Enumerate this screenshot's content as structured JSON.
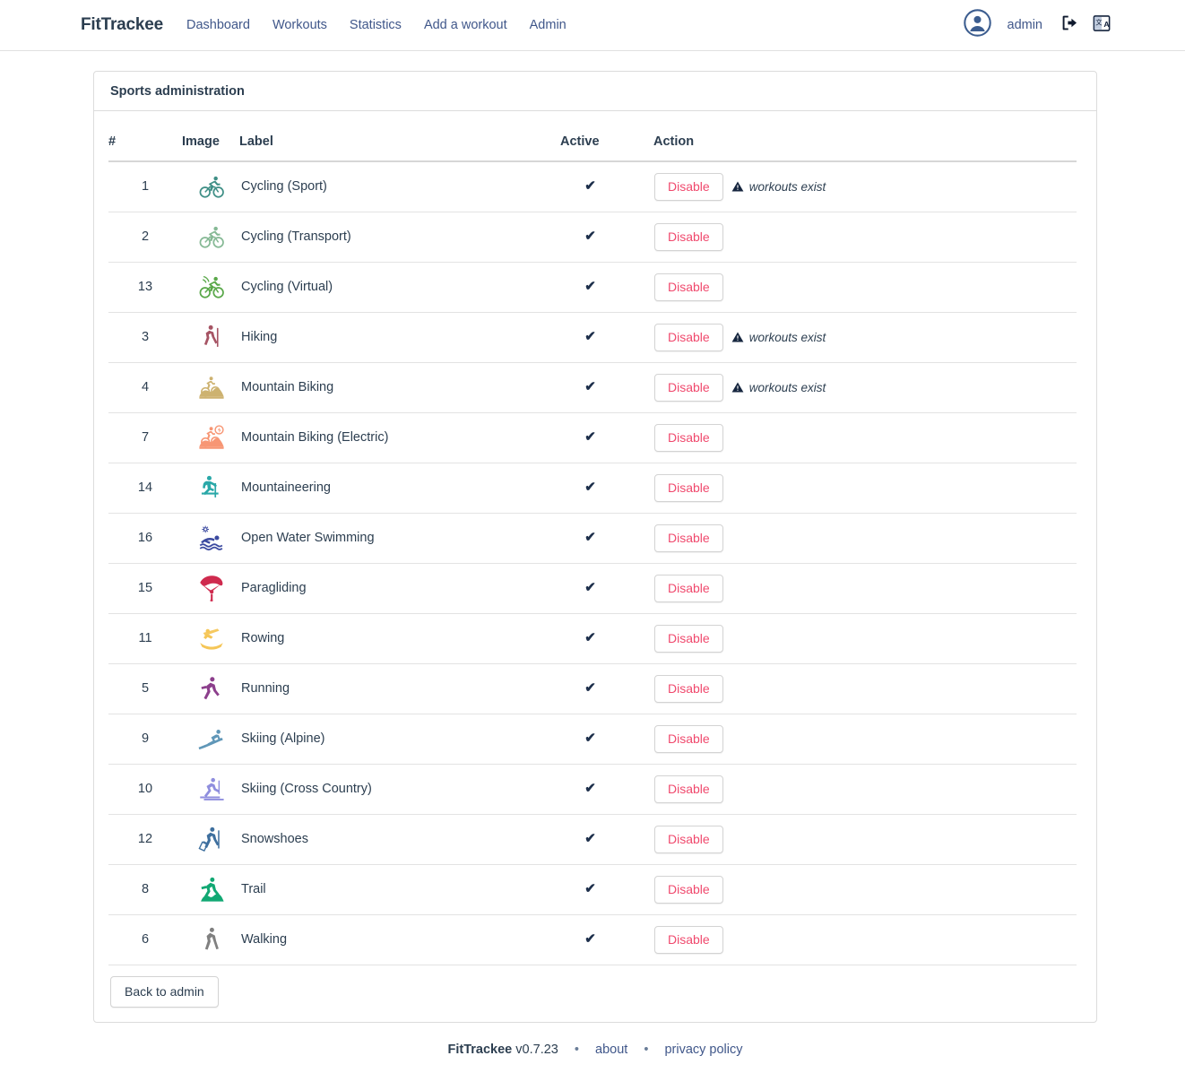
{
  "header": {
    "brand": "FitTrackee",
    "nav": [
      {
        "label": "Dashboard",
        "name": "nav-dashboard"
      },
      {
        "label": "Workouts",
        "name": "nav-workouts"
      },
      {
        "label": "Statistics",
        "name": "nav-statistics"
      },
      {
        "label": "Add a workout",
        "name": "nav-add-workout"
      },
      {
        "label": "Admin",
        "name": "nav-admin"
      }
    ],
    "user": "admin",
    "icons": {
      "avatar": "user-avatar-icon",
      "logout": "logout-icon",
      "language": "language-icon"
    }
  },
  "card": {
    "title": "Sports administration",
    "back_button": "Back to admin"
  },
  "table": {
    "columns": [
      "#",
      "Image",
      "Label",
      "Active",
      "Action"
    ],
    "action_label": "Disable",
    "warning_text": "workouts exist",
    "active_mark": "✔",
    "rows": [
      {
        "id": "1",
        "label": "Cycling (Sport)",
        "icon": "cycling-sport-icon",
        "color": "#3f8f86",
        "active": true,
        "action": "Disable",
        "warning": "workouts exist"
      },
      {
        "id": "2",
        "label": "Cycling (Transport)",
        "icon": "cycling-transport-icon",
        "color": "#86b995",
        "active": true,
        "action": "Disable",
        "warning": ""
      },
      {
        "id": "13",
        "label": "Cycling (Virtual)",
        "icon": "cycling-virtual-icon",
        "color": "#5aa84a",
        "active": true,
        "action": "Disable",
        "warning": ""
      },
      {
        "id": "3",
        "label": "Hiking",
        "icon": "hiking-icon",
        "color": "#a65464",
        "active": true,
        "action": "Disable",
        "warning": "workouts exist"
      },
      {
        "id": "4",
        "label": "Mountain Biking",
        "icon": "mountain-biking-icon",
        "color": "#cdb270",
        "active": true,
        "action": "Disable",
        "warning": "workouts exist"
      },
      {
        "id": "7",
        "label": "Mountain Biking (Electric)",
        "icon": "mountain-biking-electric-icon",
        "color": "#f79674",
        "active": true,
        "action": "Disable",
        "warning": ""
      },
      {
        "id": "14",
        "label": "Mountaineering",
        "icon": "mountaineering-icon",
        "color": "#2aa8a8",
        "active": true,
        "action": "Disable",
        "warning": ""
      },
      {
        "id": "16",
        "label": "Open Water Swimming",
        "icon": "open-water-swimming-icon",
        "color": "#3b4aa0",
        "active": true,
        "action": "Disable",
        "warning": ""
      },
      {
        "id": "15",
        "label": "Paragliding",
        "icon": "paragliding-icon",
        "color": "#cf2a4e",
        "active": true,
        "action": "Disable",
        "warning": ""
      },
      {
        "id": "11",
        "label": "Rowing",
        "icon": "rowing-icon",
        "color": "#f5c657",
        "active": true,
        "action": "Disable",
        "warning": ""
      },
      {
        "id": "5",
        "label": "Running",
        "icon": "running-icon",
        "color": "#8c3f8c",
        "active": true,
        "action": "Disable",
        "warning": ""
      },
      {
        "id": "9",
        "label": "Skiing (Alpine)",
        "icon": "skiing-alpine-icon",
        "color": "#6097b8",
        "active": true,
        "action": "Disable",
        "warning": ""
      },
      {
        "id": "10",
        "label": "Skiing (Cross Country)",
        "icon": "skiing-cross-country-icon",
        "color": "#8f8ede",
        "active": true,
        "action": "Disable",
        "warning": ""
      },
      {
        "id": "12",
        "label": "Snowshoes",
        "icon": "snowshoes-icon",
        "color": "#3e6f9e",
        "active": true,
        "action": "Disable",
        "warning": ""
      },
      {
        "id": "8",
        "label": "Trail",
        "icon": "trail-icon",
        "color": "#11a873",
        "active": true,
        "action": "Disable",
        "warning": ""
      },
      {
        "id": "6",
        "label": "Walking",
        "icon": "walking-icon",
        "color": "#808080",
        "active": true,
        "action": "Disable",
        "warning": ""
      }
    ]
  },
  "footer": {
    "app_name": "FitTrackee",
    "version": "v0.7.23",
    "separator": "•",
    "about": "about",
    "privacy": "privacy policy"
  },
  "colors": {
    "link": "#40578a",
    "text": "#2c3e50",
    "danger": "#f0496d",
    "border": "#dcdcdc"
  }
}
